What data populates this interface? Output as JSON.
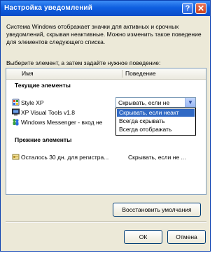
{
  "window": {
    "title": "Настройка уведомлений"
  },
  "description": "Система Windows отображает значки для активных и срочных уведомлений, скрывая неактивные. Можно изменить такое поведение для элементов следующего списка.",
  "instruction": "Выберите элемент, а затем задайте нужное поведение:",
  "list": {
    "columns": [
      "Имя",
      "Поведение"
    ],
    "groups": [
      {
        "label": "Текущие элементы",
        "items": [
          {
            "name": "Style XP",
            "behavior": "Скрывать, если не"
          },
          {
            "name": "XP Visual Tools v1.8",
            "behavior": ""
          },
          {
            "name": "Windows Messenger - вход не",
            "behavior": ""
          }
        ]
      },
      {
        "label": "Прежние элементы",
        "items": [
          {
            "name": "Осталось 30 дн. для регистра...",
            "behavior": "Скрывать, если не ..."
          }
        ]
      }
    ],
    "combo": {
      "value": "Скрывать, если не",
      "options": [
        "Скрывать, если неакт",
        "Всегда скрывать",
        "Всегда отображать"
      ],
      "selected_index": 0
    }
  },
  "buttons": {
    "restore": "Восстановить умолчания",
    "ok": "ОК",
    "cancel": "Отмена"
  },
  "icons": {
    "style_xp": "style-xp-icon",
    "xp_visual_tools": "monitor-icon",
    "messenger": "messenger-people-icon",
    "registration": "registration-key-icon"
  },
  "colors": {
    "title_bar": "#0a4cc8",
    "selection": "#316ac5",
    "dialog_bg": "#ece9d8"
  }
}
